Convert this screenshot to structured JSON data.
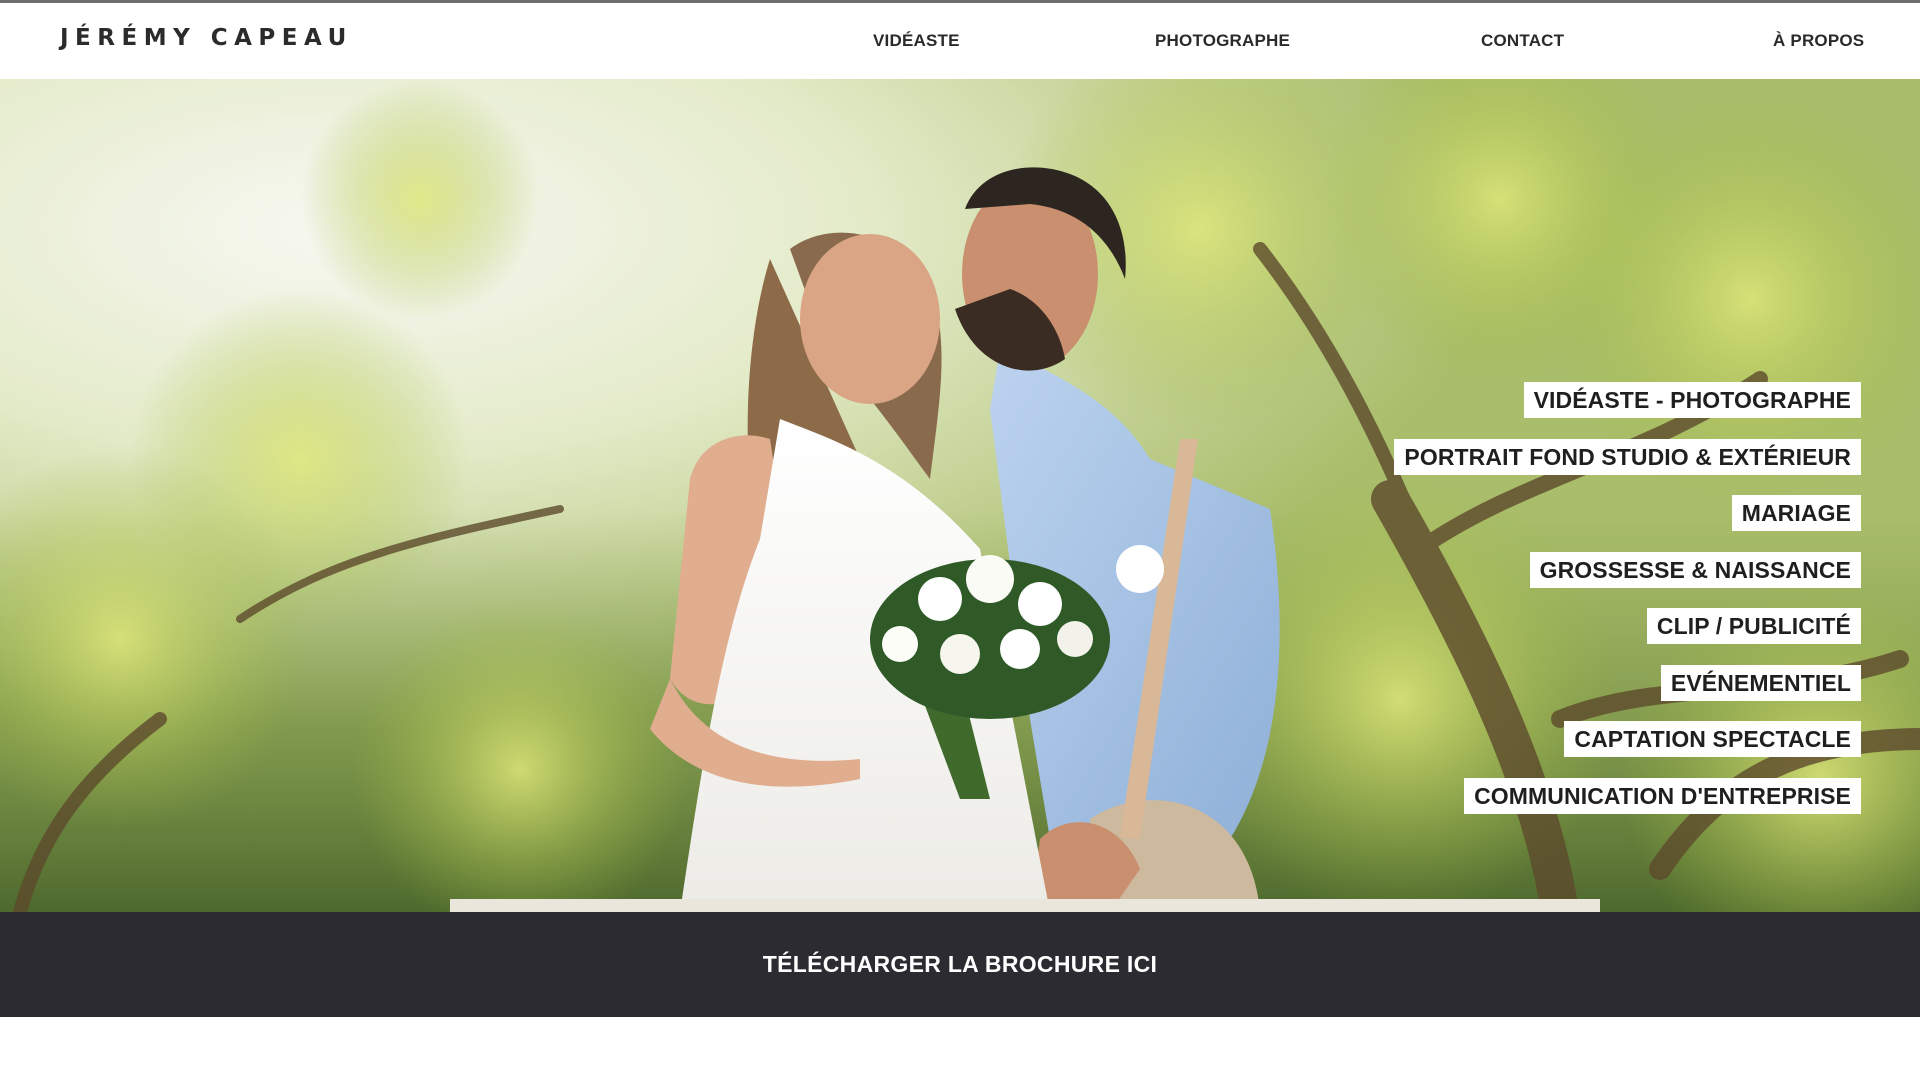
{
  "site": {
    "logo": "JÉRÉMY CAPEAU"
  },
  "nav": {
    "items": [
      {
        "label": "VIDÉASTE"
      },
      {
        "label": "PHOTOGRAPHE"
      },
      {
        "label": "CONTACT"
      },
      {
        "label": "À PROPOS"
      }
    ]
  },
  "hero": {
    "image": "wedding-couple-kissing-photo",
    "services": [
      {
        "label": "VIDÉASTE - PHOTOGRAPHE"
      },
      {
        "label": "PORTRAIT FOND STUDIO & EXTÉRIEUR"
      },
      {
        "label": "MARIAGE"
      },
      {
        "label": "GROSSESSE & NAISSANCE"
      },
      {
        "label": "CLIP / PUBLICITÉ"
      },
      {
        "label": "EVÉNEMENTIEL"
      },
      {
        "label": "CAPTATION SPECTACLE"
      },
      {
        "label": "COMMUNICATION D'ENTREPRISE"
      }
    ]
  },
  "brochure": {
    "label": "TÉLÉCHARGER LA BROCHURE ICI"
  },
  "colors": {
    "header_bg": "#ffffff",
    "text_dark": "#2a2a2a",
    "brochure_bg": "#2c2b31",
    "brochure_text": "#ffffff",
    "tag_bg": "#ffffff"
  }
}
